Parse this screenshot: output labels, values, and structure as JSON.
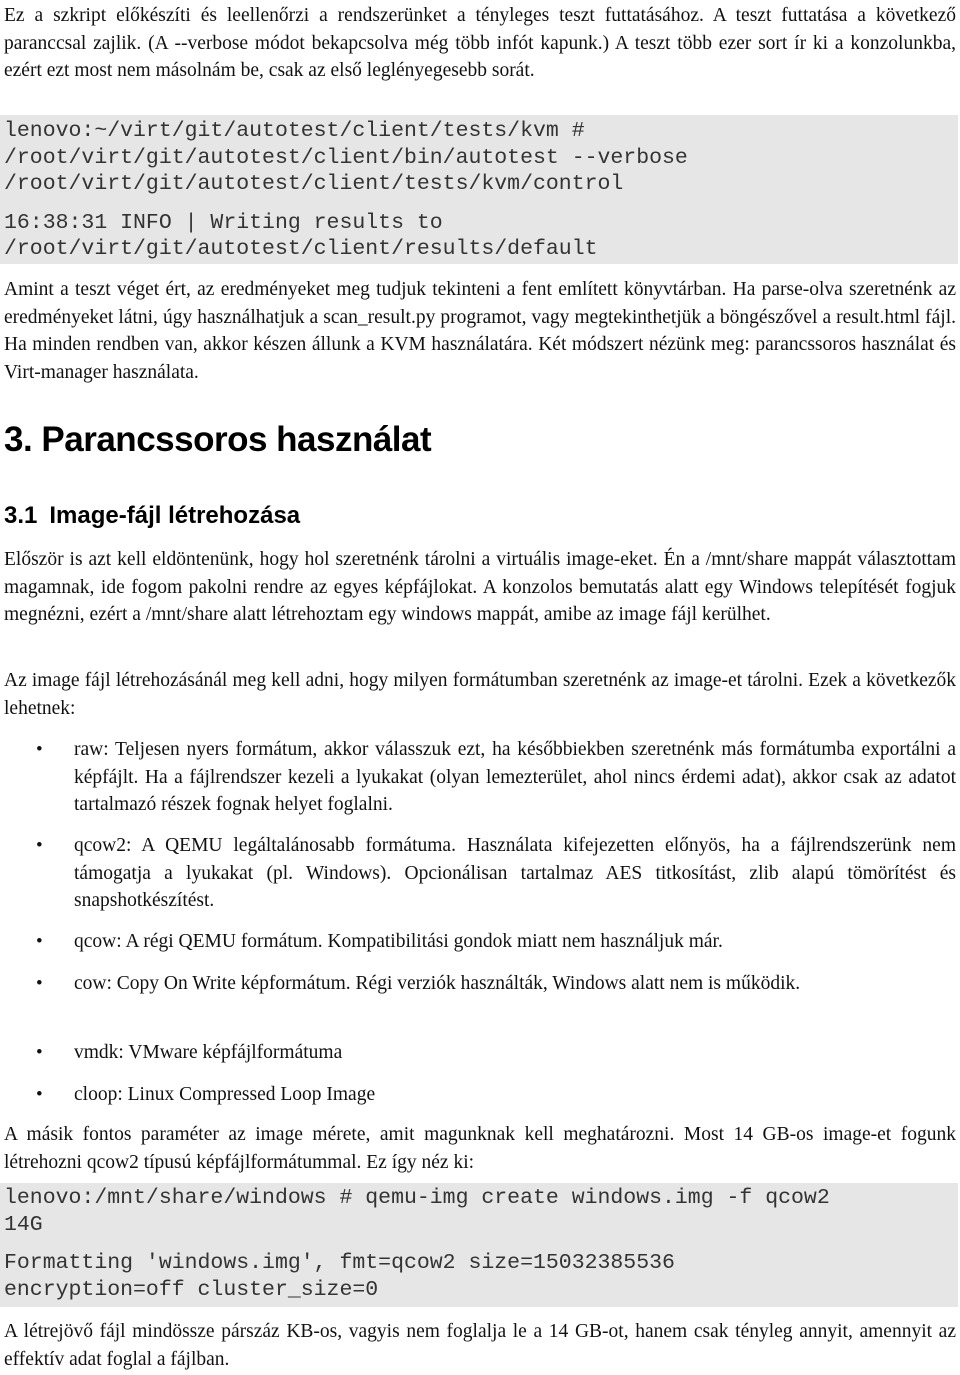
{
  "intro_paragraph": "Ez a szkript előkészíti és leellenőrzi a rendszerünket a tényleges teszt futtatásához. A teszt futtatása a következő paranccsal zajlik. (A --verbose módot bekapcsolva még több infót kapunk.) A teszt több ezer sort ír ki a konzolunkba, ezért ezt most nem másolnám be, csak az első leglényegesebb sorát.",
  "code_block_1": {
    "command_lines": [
      "lenovo:~/virt/git/autotest/client/tests/kvm #",
      "/root/virt/git/autotest/client/bin/autotest --verbose",
      "/root/virt/git/autotest/client/tests/kvm/control"
    ],
    "output_lines": [
      "16:38:31 INFO | Writing results to",
      "/root/virt/git/autotest/client/results/default"
    ]
  },
  "results_paragraph": "Amint a teszt véget ért, az eredményeket meg tudjuk tekinteni a fent említett könyvtárban. Ha parse-olva szeretnénk az eredményeket látni, úgy használhatjuk a scan_result.py programot, vagy megtekinthetjük a böngészővel a result.html fájl. Ha minden rendben van, akkor készen állunk a KVM használatára. Két módszert nézünk meg: parancssoros használat és Virt-manager használata.",
  "section_heading": "3. Parancssoros használat",
  "subsection": {
    "number": "3.1",
    "title": "Image-fájl létrehozása"
  },
  "paragraph_storage": "Először is azt kell eldöntenünk, hogy hol szeretnénk tárolni a virtuális image-eket. Én a /mnt/share mappát választottam magamnak, ide fogom pakolni rendre az egyes képfájlokat. A konzolos bemutatás alatt egy Windows telepítését fogjuk megnézni, ezért a /mnt/share alatt létrehoztam egy windows mappát, amibe az image fájl kerülhet.",
  "paragraph_format": "Az image fájl létrehozásánál meg kell adni, hogy milyen formátumban szeretnénk az image-et tárolni. Ezek a következők lehetnek:",
  "format_list": [
    {
      "bullet": "•",
      "text": "raw: Teljesen nyers formátum, akkor válasszuk ezt, ha későbbiekben szeretnénk más formátumba exportálni a képfájlt. Ha a fájlrendszer kezeli a lyukakat (olyan lemezterület, ahol nincs érdemi adat), akkor csak az adatot tartalmazó részek fognak helyet foglalni."
    },
    {
      "bullet": "•",
      "text": "qcow2: A QEMU legáltalánosabb formátuma. Használata kifejezetten előnyös, ha a fájlrendszerünk nem támogatja a lyukakat (pl. Windows). Opcionálisan tartalmaz AES titkosítást, zlib alapú tömörítést és snapshotkészítést."
    },
    {
      "bullet": "•",
      "text": "qcow: A régi QEMU formátum. Kompatibilitási gondok miatt nem használjuk már."
    },
    {
      "bullet": "•",
      "text": "cow: Copy On Write képformátum. Régi verziók használták, Windows alatt nem is működik."
    },
    {
      "bullet": "•",
      "text": "vmdk: VMware képfájlformátuma"
    },
    {
      "bullet": "•",
      "text": "cloop: Linux Compressed Loop Image"
    }
  ],
  "paragraph_size": "A másik fontos paraméter az image mérete, amit magunknak kell meghatározni. Most 14 GB-os image-et fogunk létrehozni qcow2 típusú képfájlformátummal. Ez így néz ki:",
  "code_block_2": {
    "command_lines": [
      "lenovo:/mnt/share/windows # qemu-img create windows.img -f qcow2",
      "14G"
    ],
    "output_lines": [
      "Formatting 'windows.img', fmt=qcow2 size=15032385536",
      "encryption=off cluster_size=0"
    ]
  },
  "closing_paragraph": "A létrejövő fájl mindössze párszáz KB-os, vagyis nem foglalja le a 14 GB-ot, hanem csak tényleg annyit, amennyit az effektív adat foglal a fájlban."
}
